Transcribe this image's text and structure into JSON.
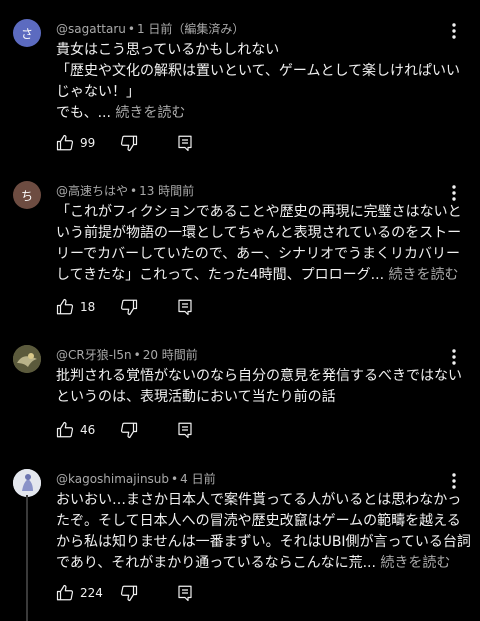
{
  "comments": [
    {
      "avatar_letter": "さ",
      "avatar_color": "#5c6bc0",
      "author": "@sagattaru",
      "time": "1 日前（編集済み）",
      "lines": [
        "貴女はこう思っているかもしれない",
        "「歴史や文化の解釈は置いといて、ゲームとして楽しけれぱいい",
        "じゃない！」",
        "でも、..."
      ],
      "read_more": "続きを読む",
      "likes": "99"
    },
    {
      "avatar_letter": "ち",
      "avatar_color": "#6d4c41",
      "author": "@高速ちはや",
      "time": "13 時間前",
      "lines": [
        "「これがフィクションであることや歴史の再現に完璧さはないと",
        "いう前提が物語の一環としてちゃんと表現されているのをストー",
        "リーでカバーしていたので、あー、シナリオでうまくリカバリー",
        "してきたな」これって、たった4時間、プロローグ..."
      ],
      "read_more": "続きを読む",
      "likes": "18"
    },
    {
      "avatar_letter": "",
      "avatar_color": "#6b6b4a",
      "author": "@CR牙狼-l5n",
      "time": "20 時間前",
      "lines": [
        "批判される覚悟がないのなら自分の意見を発信するべきではない",
        "というのは、表現活動において当たり前の話"
      ],
      "read_more": "",
      "likes": "46"
    },
    {
      "avatar_letter": "",
      "avatar_color": "#d8dce6",
      "author": "@kagoshimajinsub",
      "time": "4 日前",
      "lines": [
        "おいおい…まさか日本人で案件貰ってる人がいるとは思わなかっ",
        "たぞ。そして日本人への冒涜や歴史改竄はゲームの範疇を越える",
        "から私は知りませんは一番まずい。それはUBI側が言っている台詞",
        "であり、それがまかり通っているならこんなに荒..."
      ],
      "read_more": "続きを読む",
      "likes": "224"
    }
  ],
  "icons": {
    "like": "thumb-up-icon",
    "dislike": "thumb-down-icon",
    "reply": "reply-icon",
    "menu": "more-vert-icon"
  }
}
